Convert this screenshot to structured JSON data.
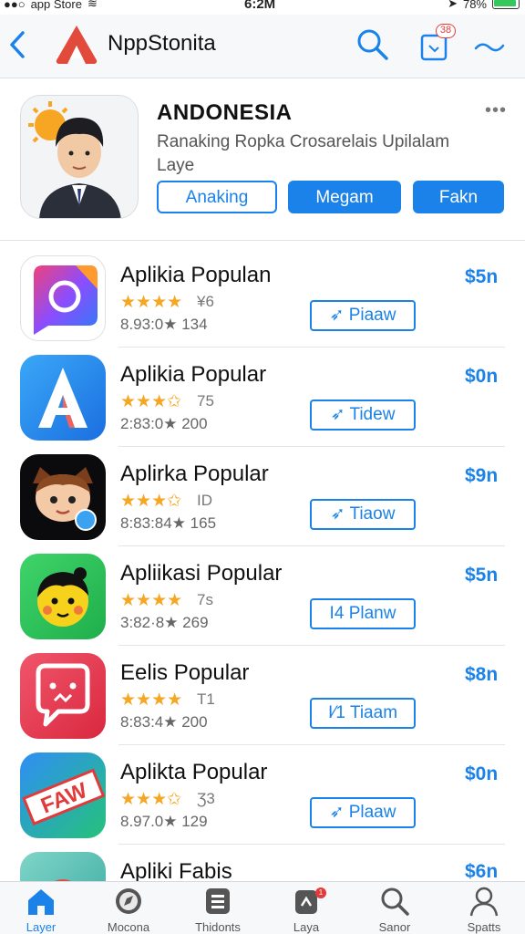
{
  "status_bar": {
    "left": "app Store",
    "time": "6:2M",
    "battery": "78%"
  },
  "nav": {
    "title": "NppStonita",
    "cart_badge": "38"
  },
  "featured": {
    "title": "ANDONESIA",
    "subtitle": "Ranaking Ropka Crosarelais Upilalam Laye",
    "more": "•••",
    "buttons": [
      "Anaking",
      "Megam",
      "Fakn"
    ]
  },
  "apps": [
    {
      "name": "Aplikia Populan",
      "stars": "★★★★",
      "rating_extra": "¥6",
      "meta": "8.93:0★ 134",
      "price": "$5n",
      "action": "Piaaw",
      "icon": "camera-app-icon"
    },
    {
      "name": "Aplikia Popular",
      "stars": "★★★✩",
      "rating_extra": "75",
      "meta": "2:83:0★ 200",
      "price": "$0n",
      "action": "Tidew",
      "icon": "letter-a-app-icon"
    },
    {
      "name": "Aplirka Popular",
      "stars": "★★★✩",
      "rating_extra": "ID",
      "meta": "8:83:84★ 165",
      "price": "$9n",
      "action": "Tiaow",
      "icon": "cartoon-character-app-icon"
    },
    {
      "name": "Apliikasi Popular",
      "stars": "★★★★",
      "rating_extra": "7s",
      "meta": "3:82·8★ 269",
      "price": "$5n",
      "action": "Planw",
      "action_prefix": "I4",
      "icon": "smiley-face-app-icon"
    },
    {
      "name": "Eelis Popular",
      "stars": "★★★★",
      "rating_extra": "T1",
      "meta": "8:83:4★ 200",
      "price": "$8n",
      "action": "Tiaam",
      "action_prefix": "I⁄1",
      "icon": "chat-bubble-app-icon"
    },
    {
      "name": "Aplikta Popular",
      "stars": "★★★✩",
      "rating_extra": "Ʒ3",
      "meta": "8.97.0★ 129",
      "price": "$0n",
      "action": "Plaaw",
      "icon": "faw-sticker-app-icon"
    },
    {
      "name": "Apliki Fabis",
      "stars": "",
      "rating_extra": "",
      "meta": "",
      "price": "$6n",
      "action": "",
      "icon": "partial-app-icon"
    }
  ],
  "tabs": [
    {
      "label": "Layer",
      "icon": "home-icon",
      "active": true
    },
    {
      "label": "Mocona",
      "icon": "compass-icon"
    },
    {
      "label": "Thidonts",
      "icon": "list-icon"
    },
    {
      "label": "Laya",
      "icon": "updates-icon",
      "badge": "1"
    },
    {
      "label": "Sanor",
      "icon": "search-icon"
    },
    {
      "label": "Spatts",
      "icon": "profile-icon"
    }
  ],
  "colors": {
    "accent": "#1a82e8",
    "star": "#f5a623",
    "badge": "#e23b3b"
  }
}
